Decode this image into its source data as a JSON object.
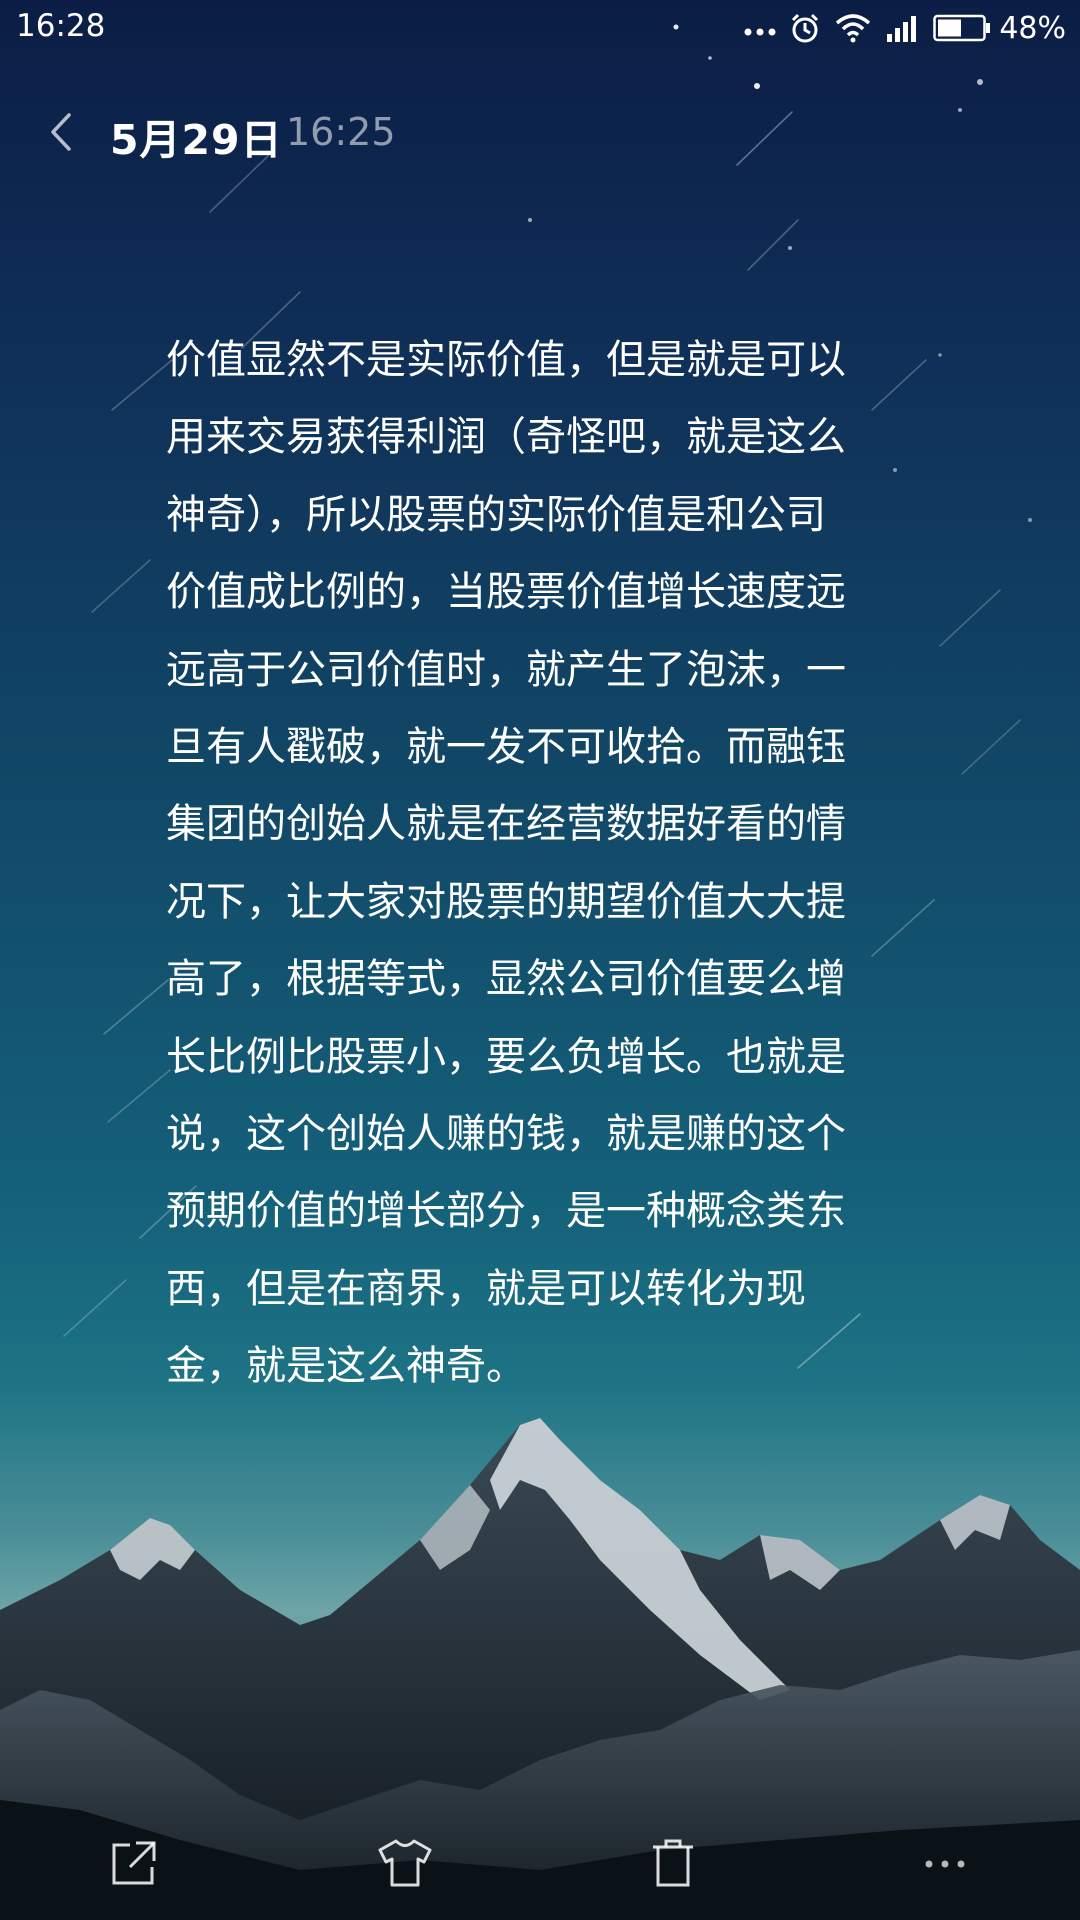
{
  "status_bar": {
    "time": "16:28",
    "icons": [
      "more-dots-icon",
      "alarm-icon",
      "wifi-icon",
      "signal-icon",
      "battery-icon"
    ],
    "battery_percent": "48%"
  },
  "header": {
    "back_icon": "chevron-left-icon",
    "date": "5月29日",
    "time": "16:25"
  },
  "note": {
    "lines": [
      "价值显然不是实际价值，但是就是可以",
      "用来交易获得利润（奇怪吧，就是这么",
      "神奇），所以股票的实际价值是和公司",
      "价值成比例的，当股票价值增长速度远",
      "远高于公司价值时，就产生了泡沫，一",
      "旦有人戳破，就一发不可收拾。而融钰",
      "集团的创始人就是在经营数据好看的情",
      "况下，让大家对股票的期望价值大大提",
      "高了，根据等式，显然公司价值要么增",
      "长比例比股票小，要么负增长。也就是",
      "说，这个创始人赚的钱，就是赚的这个",
      "预期价值的增长部分，是一种概念类东",
      "西，但是在商界，就是可以转化为现",
      "金，就是这么神奇。"
    ]
  },
  "bottom_bar": {
    "icons": [
      "share-icon",
      "theme-shirt-icon",
      "delete-icon",
      "more-icon"
    ]
  },
  "colors": {
    "sky_top": "#0b1d45",
    "sky_mid": "#14607a",
    "horizon": "#6ea5a8",
    "text": "#ffffff",
    "secondary_text": "#9fb4c4"
  }
}
